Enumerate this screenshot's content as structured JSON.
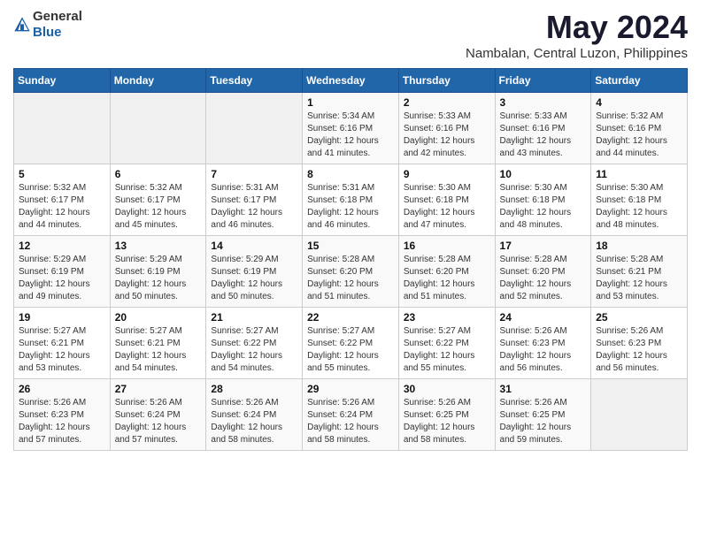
{
  "logo": {
    "text_general": "General",
    "text_blue": "Blue"
  },
  "header": {
    "month": "May 2024",
    "location": "Nambalan, Central Luzon, Philippines"
  },
  "days_of_week": [
    "Sunday",
    "Monday",
    "Tuesday",
    "Wednesday",
    "Thursday",
    "Friday",
    "Saturday"
  ],
  "weeks": [
    {
      "days": [
        {
          "num": "",
          "info": ""
        },
        {
          "num": "",
          "info": ""
        },
        {
          "num": "",
          "info": ""
        },
        {
          "num": "1",
          "info": "Sunrise: 5:34 AM\nSunset: 6:16 PM\nDaylight: 12 hours\nand 41 minutes."
        },
        {
          "num": "2",
          "info": "Sunrise: 5:33 AM\nSunset: 6:16 PM\nDaylight: 12 hours\nand 42 minutes."
        },
        {
          "num": "3",
          "info": "Sunrise: 5:33 AM\nSunset: 6:16 PM\nDaylight: 12 hours\nand 43 minutes."
        },
        {
          "num": "4",
          "info": "Sunrise: 5:32 AM\nSunset: 6:16 PM\nDaylight: 12 hours\nand 44 minutes."
        }
      ]
    },
    {
      "days": [
        {
          "num": "5",
          "info": "Sunrise: 5:32 AM\nSunset: 6:17 PM\nDaylight: 12 hours\nand 44 minutes."
        },
        {
          "num": "6",
          "info": "Sunrise: 5:32 AM\nSunset: 6:17 PM\nDaylight: 12 hours\nand 45 minutes."
        },
        {
          "num": "7",
          "info": "Sunrise: 5:31 AM\nSunset: 6:17 PM\nDaylight: 12 hours\nand 46 minutes."
        },
        {
          "num": "8",
          "info": "Sunrise: 5:31 AM\nSunset: 6:18 PM\nDaylight: 12 hours\nand 46 minutes."
        },
        {
          "num": "9",
          "info": "Sunrise: 5:30 AM\nSunset: 6:18 PM\nDaylight: 12 hours\nand 47 minutes."
        },
        {
          "num": "10",
          "info": "Sunrise: 5:30 AM\nSunset: 6:18 PM\nDaylight: 12 hours\nand 48 minutes."
        },
        {
          "num": "11",
          "info": "Sunrise: 5:30 AM\nSunset: 6:18 PM\nDaylight: 12 hours\nand 48 minutes."
        }
      ]
    },
    {
      "days": [
        {
          "num": "12",
          "info": "Sunrise: 5:29 AM\nSunset: 6:19 PM\nDaylight: 12 hours\nand 49 minutes."
        },
        {
          "num": "13",
          "info": "Sunrise: 5:29 AM\nSunset: 6:19 PM\nDaylight: 12 hours\nand 50 minutes."
        },
        {
          "num": "14",
          "info": "Sunrise: 5:29 AM\nSunset: 6:19 PM\nDaylight: 12 hours\nand 50 minutes."
        },
        {
          "num": "15",
          "info": "Sunrise: 5:28 AM\nSunset: 6:20 PM\nDaylight: 12 hours\nand 51 minutes."
        },
        {
          "num": "16",
          "info": "Sunrise: 5:28 AM\nSunset: 6:20 PM\nDaylight: 12 hours\nand 51 minutes."
        },
        {
          "num": "17",
          "info": "Sunrise: 5:28 AM\nSunset: 6:20 PM\nDaylight: 12 hours\nand 52 minutes."
        },
        {
          "num": "18",
          "info": "Sunrise: 5:28 AM\nSunset: 6:21 PM\nDaylight: 12 hours\nand 53 minutes."
        }
      ]
    },
    {
      "days": [
        {
          "num": "19",
          "info": "Sunrise: 5:27 AM\nSunset: 6:21 PM\nDaylight: 12 hours\nand 53 minutes."
        },
        {
          "num": "20",
          "info": "Sunrise: 5:27 AM\nSunset: 6:21 PM\nDaylight: 12 hours\nand 54 minutes."
        },
        {
          "num": "21",
          "info": "Sunrise: 5:27 AM\nSunset: 6:22 PM\nDaylight: 12 hours\nand 54 minutes."
        },
        {
          "num": "22",
          "info": "Sunrise: 5:27 AM\nSunset: 6:22 PM\nDaylight: 12 hours\nand 55 minutes."
        },
        {
          "num": "23",
          "info": "Sunrise: 5:27 AM\nSunset: 6:22 PM\nDaylight: 12 hours\nand 55 minutes."
        },
        {
          "num": "24",
          "info": "Sunrise: 5:26 AM\nSunset: 6:23 PM\nDaylight: 12 hours\nand 56 minutes."
        },
        {
          "num": "25",
          "info": "Sunrise: 5:26 AM\nSunset: 6:23 PM\nDaylight: 12 hours\nand 56 minutes."
        }
      ]
    },
    {
      "days": [
        {
          "num": "26",
          "info": "Sunrise: 5:26 AM\nSunset: 6:23 PM\nDaylight: 12 hours\nand 57 minutes."
        },
        {
          "num": "27",
          "info": "Sunrise: 5:26 AM\nSunset: 6:24 PM\nDaylight: 12 hours\nand 57 minutes."
        },
        {
          "num": "28",
          "info": "Sunrise: 5:26 AM\nSunset: 6:24 PM\nDaylight: 12 hours\nand 58 minutes."
        },
        {
          "num": "29",
          "info": "Sunrise: 5:26 AM\nSunset: 6:24 PM\nDaylight: 12 hours\nand 58 minutes."
        },
        {
          "num": "30",
          "info": "Sunrise: 5:26 AM\nSunset: 6:25 PM\nDaylight: 12 hours\nand 58 minutes."
        },
        {
          "num": "31",
          "info": "Sunrise: 5:26 AM\nSunset: 6:25 PM\nDaylight: 12 hours\nand 59 minutes."
        },
        {
          "num": "",
          "info": ""
        }
      ]
    }
  ]
}
